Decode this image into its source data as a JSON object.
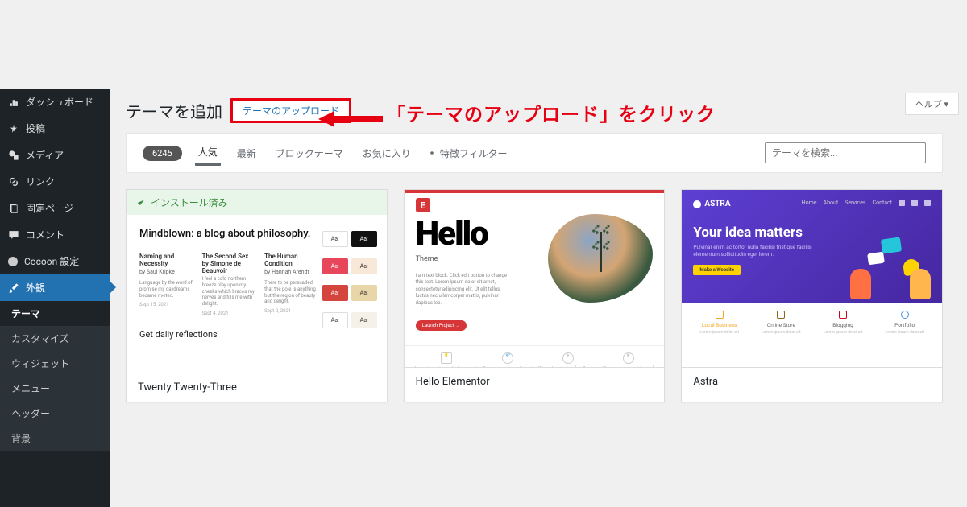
{
  "sidebar": {
    "items": [
      {
        "label": "ダッシュボード",
        "icon": "dashboard"
      },
      {
        "label": "投稿",
        "icon": "pin"
      },
      {
        "label": "メディア",
        "icon": "media"
      },
      {
        "label": "リンク",
        "icon": "link"
      },
      {
        "label": "固定ページ",
        "icon": "page"
      },
      {
        "label": "コメント",
        "icon": "comment"
      },
      {
        "label": "Cocoon 設定",
        "icon": "cocoon"
      },
      {
        "label": "外観",
        "icon": "brush"
      }
    ],
    "submenu": [
      "テーマ",
      "カスタマイズ",
      "ウィジェット",
      "メニュー",
      "ヘッダー",
      "背景"
    ]
  },
  "header": {
    "title": "テーマを追加",
    "upload_button": "テーマのアップロード",
    "help": "ヘルプ ▾"
  },
  "callout": {
    "text": "「テーマのアップロード」をクリック"
  },
  "filters": {
    "count": "6245",
    "tabs": [
      "人気",
      "最新",
      "ブロックテーマ",
      "お気に入り"
    ],
    "feature_filter": "特徴フィルター",
    "search_placeholder": "テーマを検索..."
  },
  "themes": [
    {
      "name": "Twenty Twenty-Three",
      "installed": "インストール済み",
      "preview": {
        "headline": "Mindblown: a blog about philosophy.",
        "columns": [
          {
            "title": "Naming and Necessity",
            "author": "by Saul Kripke",
            "date": "Sept 15, 2021"
          },
          {
            "title": "The Second Sex by Simone de Beauvoir",
            "author": "",
            "date": "Sept 4, 2021"
          },
          {
            "title": "The Human Condition",
            "author": "by Hannah Arendt",
            "date": "Sept 2, 2021"
          }
        ],
        "daily": "Get daily reflections"
      }
    },
    {
      "name": "Hello Elementor",
      "preview": {
        "hello": "Hello",
        "sub": "Theme",
        "button": "Launch Project  →"
      }
    },
    {
      "name": "Astra",
      "preview": {
        "logo": "ASTRA",
        "nav": [
          "Home",
          "About",
          "Services",
          "Contact"
        ],
        "tagline": "Your idea matters",
        "sub": "Pulvinar enim ac tortor nulla facilisi tristique facilisi elementum sollicitudin eget lorem.",
        "cta": "Make a Website",
        "features": [
          {
            "label": "Local Business"
          },
          {
            "label": "Online Store"
          },
          {
            "label": "Blogging"
          },
          {
            "label": "Portfolio"
          }
        ]
      }
    }
  ]
}
